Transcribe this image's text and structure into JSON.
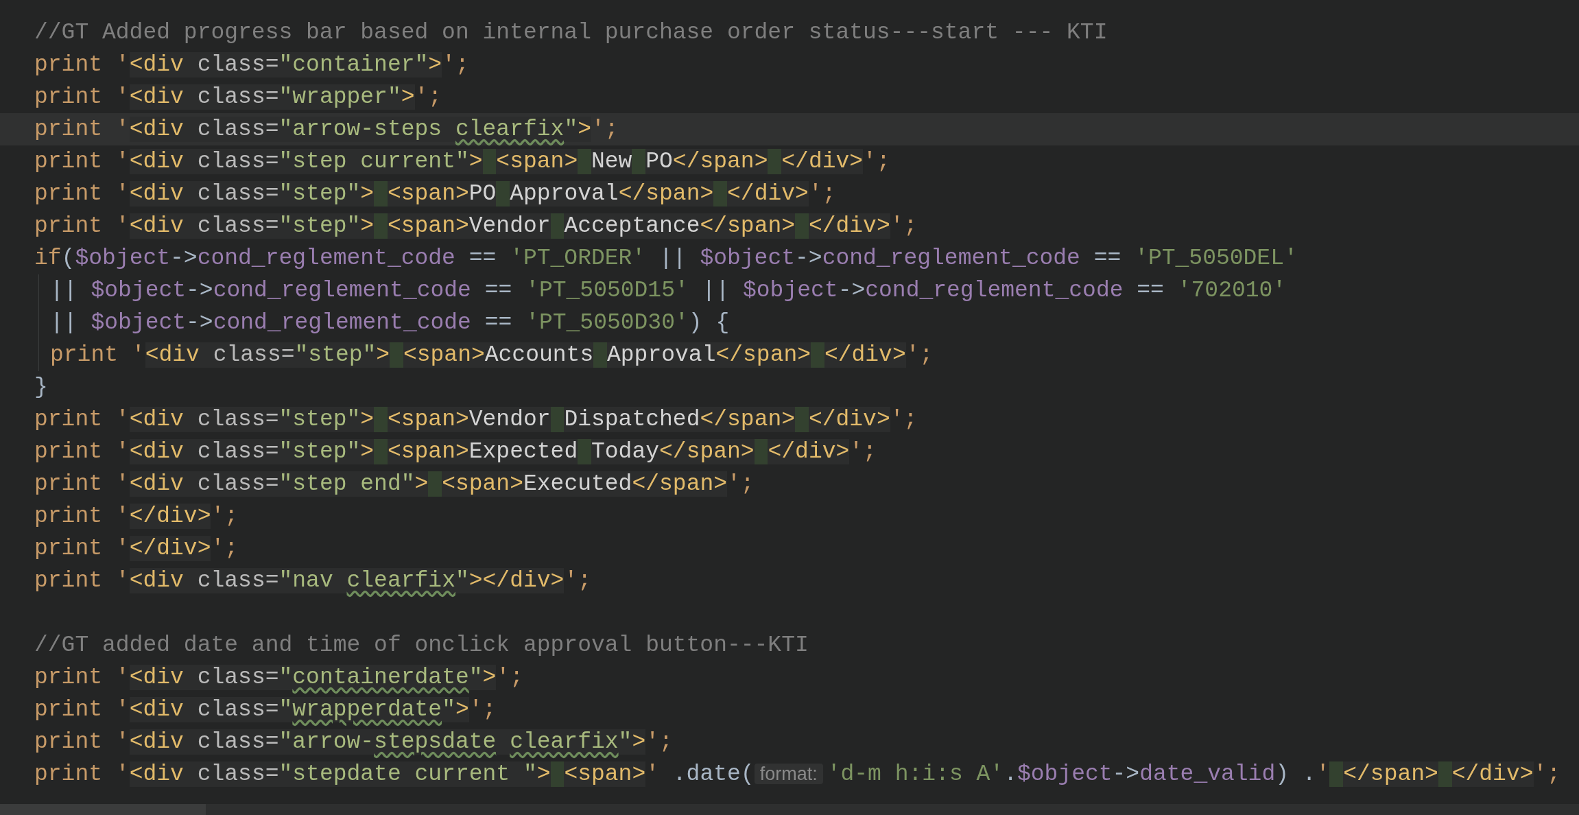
{
  "editor": {
    "lines": [
      {
        "current": false,
        "tokens": [
          {
            "kind": "comment",
            "text": "//GT Added progress bar based on internal purchase order status---start --- KTI"
          }
        ]
      },
      {
        "current": false,
        "tokens": [
          {
            "kind": "kw",
            "text": "print"
          },
          {
            "kind": "q",
            "text": " '"
          },
          {
            "kind": "tag",
            "text": "<div"
          },
          {
            "kind": "attr",
            "text": " class="
          },
          {
            "kind": "val",
            "text": "\"container\""
          },
          {
            "kind": "tag",
            "text": ">"
          },
          {
            "kind": "q",
            "text": "';"
          }
        ]
      },
      {
        "current": false,
        "tokens": [
          {
            "kind": "kw",
            "text": "print"
          },
          {
            "kind": "q",
            "text": " '"
          },
          {
            "kind": "tag",
            "text": "<div"
          },
          {
            "kind": "attr",
            "text": " class="
          },
          {
            "kind": "val",
            "text": "\"wrapper\""
          },
          {
            "kind": "tag",
            "text": ">"
          },
          {
            "kind": "q",
            "text": "';"
          }
        ]
      },
      {
        "current": true,
        "tokens": [
          {
            "kind": "kw",
            "text": "print"
          },
          {
            "kind": "q",
            "text": " '"
          },
          {
            "kind": "tag",
            "text": "<div"
          },
          {
            "kind": "attr",
            "text": " class="
          },
          {
            "kind": "val",
            "text": "\"arrow-steps"
          },
          {
            "kind": "sp"
          },
          {
            "kind": "typo",
            "text": "clearfix"
          },
          {
            "kind": "val",
            "text": "\""
          },
          {
            "kind": "tag",
            "text": ">"
          },
          {
            "kind": "q",
            "text": "';"
          }
        ]
      },
      {
        "current": false,
        "tokens": [
          {
            "kind": "kw",
            "text": "print"
          },
          {
            "kind": "q",
            "text": " '"
          },
          {
            "kind": "tag",
            "text": "<div"
          },
          {
            "kind": "attr",
            "text": " class="
          },
          {
            "kind": "val",
            "text": "\"step current\""
          },
          {
            "kind": "tag",
            "text": ">"
          },
          {
            "kind": "ws"
          },
          {
            "kind": "tag",
            "text": "<span>"
          },
          {
            "kind": "ws"
          },
          {
            "kind": "text",
            "text": "New"
          },
          {
            "kind": "ws"
          },
          {
            "kind": "text",
            "text": "PO"
          },
          {
            "kind": "tag",
            "text": "</span>"
          },
          {
            "kind": "ws"
          },
          {
            "kind": "tag",
            "text": "</div>"
          },
          {
            "kind": "q",
            "text": "';"
          }
        ]
      },
      {
        "current": false,
        "tokens": [
          {
            "kind": "kw",
            "text": "print"
          },
          {
            "kind": "q",
            "text": " '"
          },
          {
            "kind": "tag",
            "text": "<div"
          },
          {
            "kind": "attr",
            "text": " class="
          },
          {
            "kind": "val",
            "text": "\"step\""
          },
          {
            "kind": "tag",
            "text": ">"
          },
          {
            "kind": "ws"
          },
          {
            "kind": "tag",
            "text": "<span>"
          },
          {
            "kind": "text",
            "text": "PO"
          },
          {
            "kind": "ws"
          },
          {
            "kind": "text",
            "text": "Approval"
          },
          {
            "kind": "tag",
            "text": "</span>"
          },
          {
            "kind": "ws"
          },
          {
            "kind": "tag",
            "text": "</div>"
          },
          {
            "kind": "q",
            "text": "';"
          }
        ]
      },
      {
        "current": false,
        "tokens": [
          {
            "kind": "kw",
            "text": "print"
          },
          {
            "kind": "q",
            "text": " '"
          },
          {
            "kind": "tag",
            "text": "<div"
          },
          {
            "kind": "attr",
            "text": " class="
          },
          {
            "kind": "val",
            "text": "\"step\""
          },
          {
            "kind": "tag",
            "text": ">"
          },
          {
            "kind": "ws"
          },
          {
            "kind": "tag",
            "text": "<span>"
          },
          {
            "kind": "text",
            "text": "Vendor"
          },
          {
            "kind": "ws"
          },
          {
            "kind": "text",
            "text": "Acceptance"
          },
          {
            "kind": "tag",
            "text": "</span>"
          },
          {
            "kind": "ws"
          },
          {
            "kind": "tag",
            "text": "</div>"
          },
          {
            "kind": "q",
            "text": "';"
          }
        ]
      },
      {
        "current": false,
        "tokens": [
          {
            "kind": "kw",
            "text": "if"
          },
          {
            "kind": "plain",
            "text": "("
          },
          {
            "kind": "var",
            "text": "$object"
          },
          {
            "kind": "plain",
            "text": "->"
          },
          {
            "kind": "var",
            "text": "cond_reglement_code"
          },
          {
            "kind": "plain",
            "text": " == "
          },
          {
            "kind": "str",
            "text": "'PT_ORDER'"
          },
          {
            "kind": "plain",
            "text": " || "
          },
          {
            "kind": "var",
            "text": "$object"
          },
          {
            "kind": "plain",
            "text": "->"
          },
          {
            "kind": "var",
            "text": "cond_reglement_code"
          },
          {
            "kind": "plain",
            "text": " == "
          },
          {
            "kind": "str",
            "text": "'PT_5050DEL'"
          }
        ],
        "children": [
          {
            "current": false,
            "tokens": [
              {
                "kind": "plain",
                "text": "|| "
              },
              {
                "kind": "var",
                "text": "$object"
              },
              {
                "kind": "plain",
                "text": "->"
              },
              {
                "kind": "var",
                "text": "cond_reglement_code"
              },
              {
                "kind": "plain",
                "text": " == "
              },
              {
                "kind": "str",
                "text": "'PT_5050D15'"
              },
              {
                "kind": "plain",
                "text": " || "
              },
              {
                "kind": "var",
                "text": "$object"
              },
              {
                "kind": "plain",
                "text": "->"
              },
              {
                "kind": "var",
                "text": "cond_reglement_code"
              },
              {
                "kind": "plain",
                "text": " == "
              },
              {
                "kind": "str",
                "text": "'702010'"
              }
            ]
          },
          {
            "current": false,
            "tokens": [
              {
                "kind": "plain",
                "text": "|| "
              },
              {
                "kind": "var",
                "text": "$object"
              },
              {
                "kind": "plain",
                "text": "->"
              },
              {
                "kind": "var",
                "text": "cond_reglement_code"
              },
              {
                "kind": "plain",
                "text": " == "
              },
              {
                "kind": "str",
                "text": "'PT_5050D30'"
              },
              {
                "kind": "plain",
                "text": ") {"
              }
            ]
          },
          {
            "current": false,
            "tokens": [
              {
                "kind": "kw",
                "text": "print"
              },
              {
                "kind": "q",
                "text": " '"
              },
              {
                "kind": "tag",
                "text": "<div"
              },
              {
                "kind": "attr",
                "text": " class="
              },
              {
                "kind": "val",
                "text": "\"step\""
              },
              {
                "kind": "tag",
                "text": ">"
              },
              {
                "kind": "ws"
              },
              {
                "kind": "tag",
                "text": "<span>"
              },
              {
                "kind": "text",
                "text": "Accounts"
              },
              {
                "kind": "ws"
              },
              {
                "kind": "text",
                "text": "Approval"
              },
              {
                "kind": "tag",
                "text": "</span>"
              },
              {
                "kind": "ws"
              },
              {
                "kind": "tag",
                "text": "</div>"
              },
              {
                "kind": "q",
                "text": "';"
              }
            ]
          }
        ]
      },
      {
        "current": false,
        "tokens": [
          {
            "kind": "plain",
            "text": "}"
          }
        ]
      },
      {
        "current": false,
        "tokens": [
          {
            "kind": "kw",
            "text": "print"
          },
          {
            "kind": "q",
            "text": " '"
          },
          {
            "kind": "tag",
            "text": "<div"
          },
          {
            "kind": "attr",
            "text": " class="
          },
          {
            "kind": "val",
            "text": "\"step\""
          },
          {
            "kind": "tag",
            "text": ">"
          },
          {
            "kind": "ws"
          },
          {
            "kind": "tag",
            "text": "<span>"
          },
          {
            "kind": "text",
            "text": "Vendor"
          },
          {
            "kind": "ws"
          },
          {
            "kind": "text",
            "text": "Dispatched"
          },
          {
            "kind": "tag",
            "text": "</span>"
          },
          {
            "kind": "ws"
          },
          {
            "kind": "tag",
            "text": "</div>"
          },
          {
            "kind": "q",
            "text": "';"
          }
        ]
      },
      {
        "current": false,
        "tokens": [
          {
            "kind": "kw",
            "text": "print"
          },
          {
            "kind": "q",
            "text": " '"
          },
          {
            "kind": "tag",
            "text": "<div"
          },
          {
            "kind": "attr",
            "text": " class="
          },
          {
            "kind": "val",
            "text": "\"step\""
          },
          {
            "kind": "tag",
            "text": ">"
          },
          {
            "kind": "ws"
          },
          {
            "kind": "tag",
            "text": "<span>"
          },
          {
            "kind": "text",
            "text": "Expected"
          },
          {
            "kind": "ws"
          },
          {
            "kind": "text",
            "text": "Today"
          },
          {
            "kind": "tag",
            "text": "</span>"
          },
          {
            "kind": "ws"
          },
          {
            "kind": "tag",
            "text": "</div>"
          },
          {
            "kind": "q",
            "text": "';"
          }
        ]
      },
      {
        "current": false,
        "tokens": [
          {
            "kind": "kw",
            "text": "print"
          },
          {
            "kind": "q",
            "text": " '"
          },
          {
            "kind": "tag",
            "text": "<div"
          },
          {
            "kind": "attr",
            "text": " class="
          },
          {
            "kind": "val",
            "text": "\"step end\""
          },
          {
            "kind": "tag",
            "text": ">"
          },
          {
            "kind": "ws"
          },
          {
            "kind": "tag",
            "text": "<span>"
          },
          {
            "kind": "text",
            "text": "Executed"
          },
          {
            "kind": "tag",
            "text": "</span>"
          },
          {
            "kind": "q",
            "text": "';"
          }
        ]
      },
      {
        "current": false,
        "tokens": [
          {
            "kind": "kw",
            "text": "print"
          },
          {
            "kind": "q",
            "text": " '"
          },
          {
            "kind": "tag",
            "text": "</div>"
          },
          {
            "kind": "q",
            "text": "';"
          }
        ]
      },
      {
        "current": false,
        "tokens": [
          {
            "kind": "kw",
            "text": "print"
          },
          {
            "kind": "q",
            "text": " '"
          },
          {
            "kind": "tag",
            "text": "</div>"
          },
          {
            "kind": "q",
            "text": "';"
          }
        ]
      },
      {
        "current": false,
        "tokens": [
          {
            "kind": "kw",
            "text": "print"
          },
          {
            "kind": "q",
            "text": " '"
          },
          {
            "kind": "tag",
            "text": "<div"
          },
          {
            "kind": "attr",
            "text": " class="
          },
          {
            "kind": "val",
            "text": "\"nav"
          },
          {
            "kind": "sp"
          },
          {
            "kind": "typo",
            "text": "clearfix"
          },
          {
            "kind": "val",
            "text": "\""
          },
          {
            "kind": "tag",
            "text": "></div>"
          },
          {
            "kind": "q",
            "text": "';"
          }
        ]
      },
      {
        "current": false
      },
      {
        "current": false,
        "tokens": [
          {
            "kind": "comment",
            "text": "//GT added date and time of onclick approval button---KTI"
          }
        ]
      },
      {
        "current": false,
        "tokens": [
          {
            "kind": "kw",
            "text": "print"
          },
          {
            "kind": "q",
            "text": " '"
          },
          {
            "kind": "tag",
            "text": "<div"
          },
          {
            "kind": "attr",
            "text": " class="
          },
          {
            "kind": "val",
            "text": "\""
          },
          {
            "kind": "typo",
            "text": "containerdate"
          },
          {
            "kind": "val",
            "text": "\""
          },
          {
            "kind": "tag",
            "text": ">"
          },
          {
            "kind": "q",
            "text": "';"
          }
        ]
      },
      {
        "current": false,
        "tokens": [
          {
            "kind": "kw",
            "text": "print"
          },
          {
            "kind": "q",
            "text": " '"
          },
          {
            "kind": "tag",
            "text": "<div"
          },
          {
            "kind": "attr",
            "text": " class="
          },
          {
            "kind": "val",
            "text": "\""
          },
          {
            "kind": "typo",
            "text": "wrapperdate"
          },
          {
            "kind": "val",
            "text": "\""
          },
          {
            "kind": "tag",
            "text": ">"
          },
          {
            "kind": "q",
            "text": "';"
          }
        ]
      },
      {
        "current": false,
        "tokens": [
          {
            "kind": "kw",
            "text": "print"
          },
          {
            "kind": "q",
            "text": " '"
          },
          {
            "kind": "tag",
            "text": "<div"
          },
          {
            "kind": "attr",
            "text": " class="
          },
          {
            "kind": "val",
            "text": "\"arrow-"
          },
          {
            "kind": "typo",
            "text": "stepsdate"
          },
          {
            "kind": "sp"
          },
          {
            "kind": "typo",
            "text": "clearfix"
          },
          {
            "kind": "val",
            "text": "\""
          },
          {
            "kind": "tag",
            "text": ">"
          },
          {
            "kind": "q",
            "text": "';"
          }
        ]
      },
      {
        "current": false,
        "tokens": [
          {
            "kind": "kw",
            "text": "print"
          },
          {
            "kind": "q",
            "text": " '"
          },
          {
            "kind": "tag",
            "text": "<div"
          },
          {
            "kind": "attr",
            "text": " class="
          },
          {
            "kind": "val",
            "text": "\"stepdate current \""
          },
          {
            "kind": "tag",
            "text": ">"
          },
          {
            "kind": "ws"
          },
          {
            "kind": "tag",
            "text": "<span>"
          },
          {
            "kind": "q",
            "text": "'"
          },
          {
            "kind": "plain",
            "text": " .date("
          },
          {
            "kind": "hint",
            "text": "format:"
          },
          {
            "kind": "str",
            "text": "'d-m h:i:s A'"
          },
          {
            "kind": "plain",
            "text": "."
          },
          {
            "kind": "var",
            "text": "$object"
          },
          {
            "kind": "plain",
            "text": "->"
          },
          {
            "kind": "var",
            "text": "date_valid"
          },
          {
            "kind": "plain",
            "text": ") ."
          },
          {
            "kind": "q",
            "text": "'"
          },
          {
            "kind": "ws"
          },
          {
            "kind": "tag",
            "text": "</span>"
          },
          {
            "kind": "ws"
          },
          {
            "kind": "tag",
            "text": "</div>"
          },
          {
            "kind": "q",
            "text": "';"
          }
        ]
      }
    ]
  }
}
